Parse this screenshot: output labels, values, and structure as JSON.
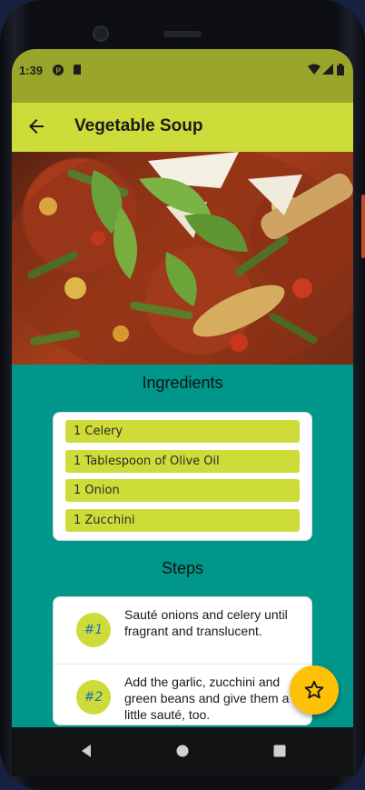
{
  "status_bar": {
    "time": "1:39",
    "icons": [
      "app-notification-icon",
      "sd-card-icon",
      "wifi-icon",
      "signal-icon",
      "battery-icon"
    ]
  },
  "toolbar": {
    "back_icon": "arrow-left-icon",
    "title": "Vegetable Soup",
    "color": "#cddc39"
  },
  "hero_image": {
    "subject": "vegetable soup in a pot"
  },
  "ingredients": {
    "heading": "Ingredients",
    "items": [
      "1 Celery",
      "1 Tablespoon of Olive Oil",
      "1 Onion",
      "1 Zucchini"
    ]
  },
  "steps": {
    "heading": "Steps",
    "items": [
      {
        "number": "#1",
        "text": "Sauté onions and celery until fragrant and translucent."
      },
      {
        "number": "#2",
        "text": "Add the garlic, zucchini and green beans and give them a little sauté, too."
      }
    ]
  },
  "fab": {
    "icon": "star-outline-icon",
    "color": "#ffc107"
  },
  "colors": {
    "status_bar": "#9aa629",
    "content_background": "#00968a",
    "accent": "#cddc39",
    "step_number_text": "#1e6fb8"
  },
  "nav_bar": {
    "icons": [
      "back-triangle-icon",
      "home-circle-icon",
      "recents-square-icon"
    ]
  }
}
